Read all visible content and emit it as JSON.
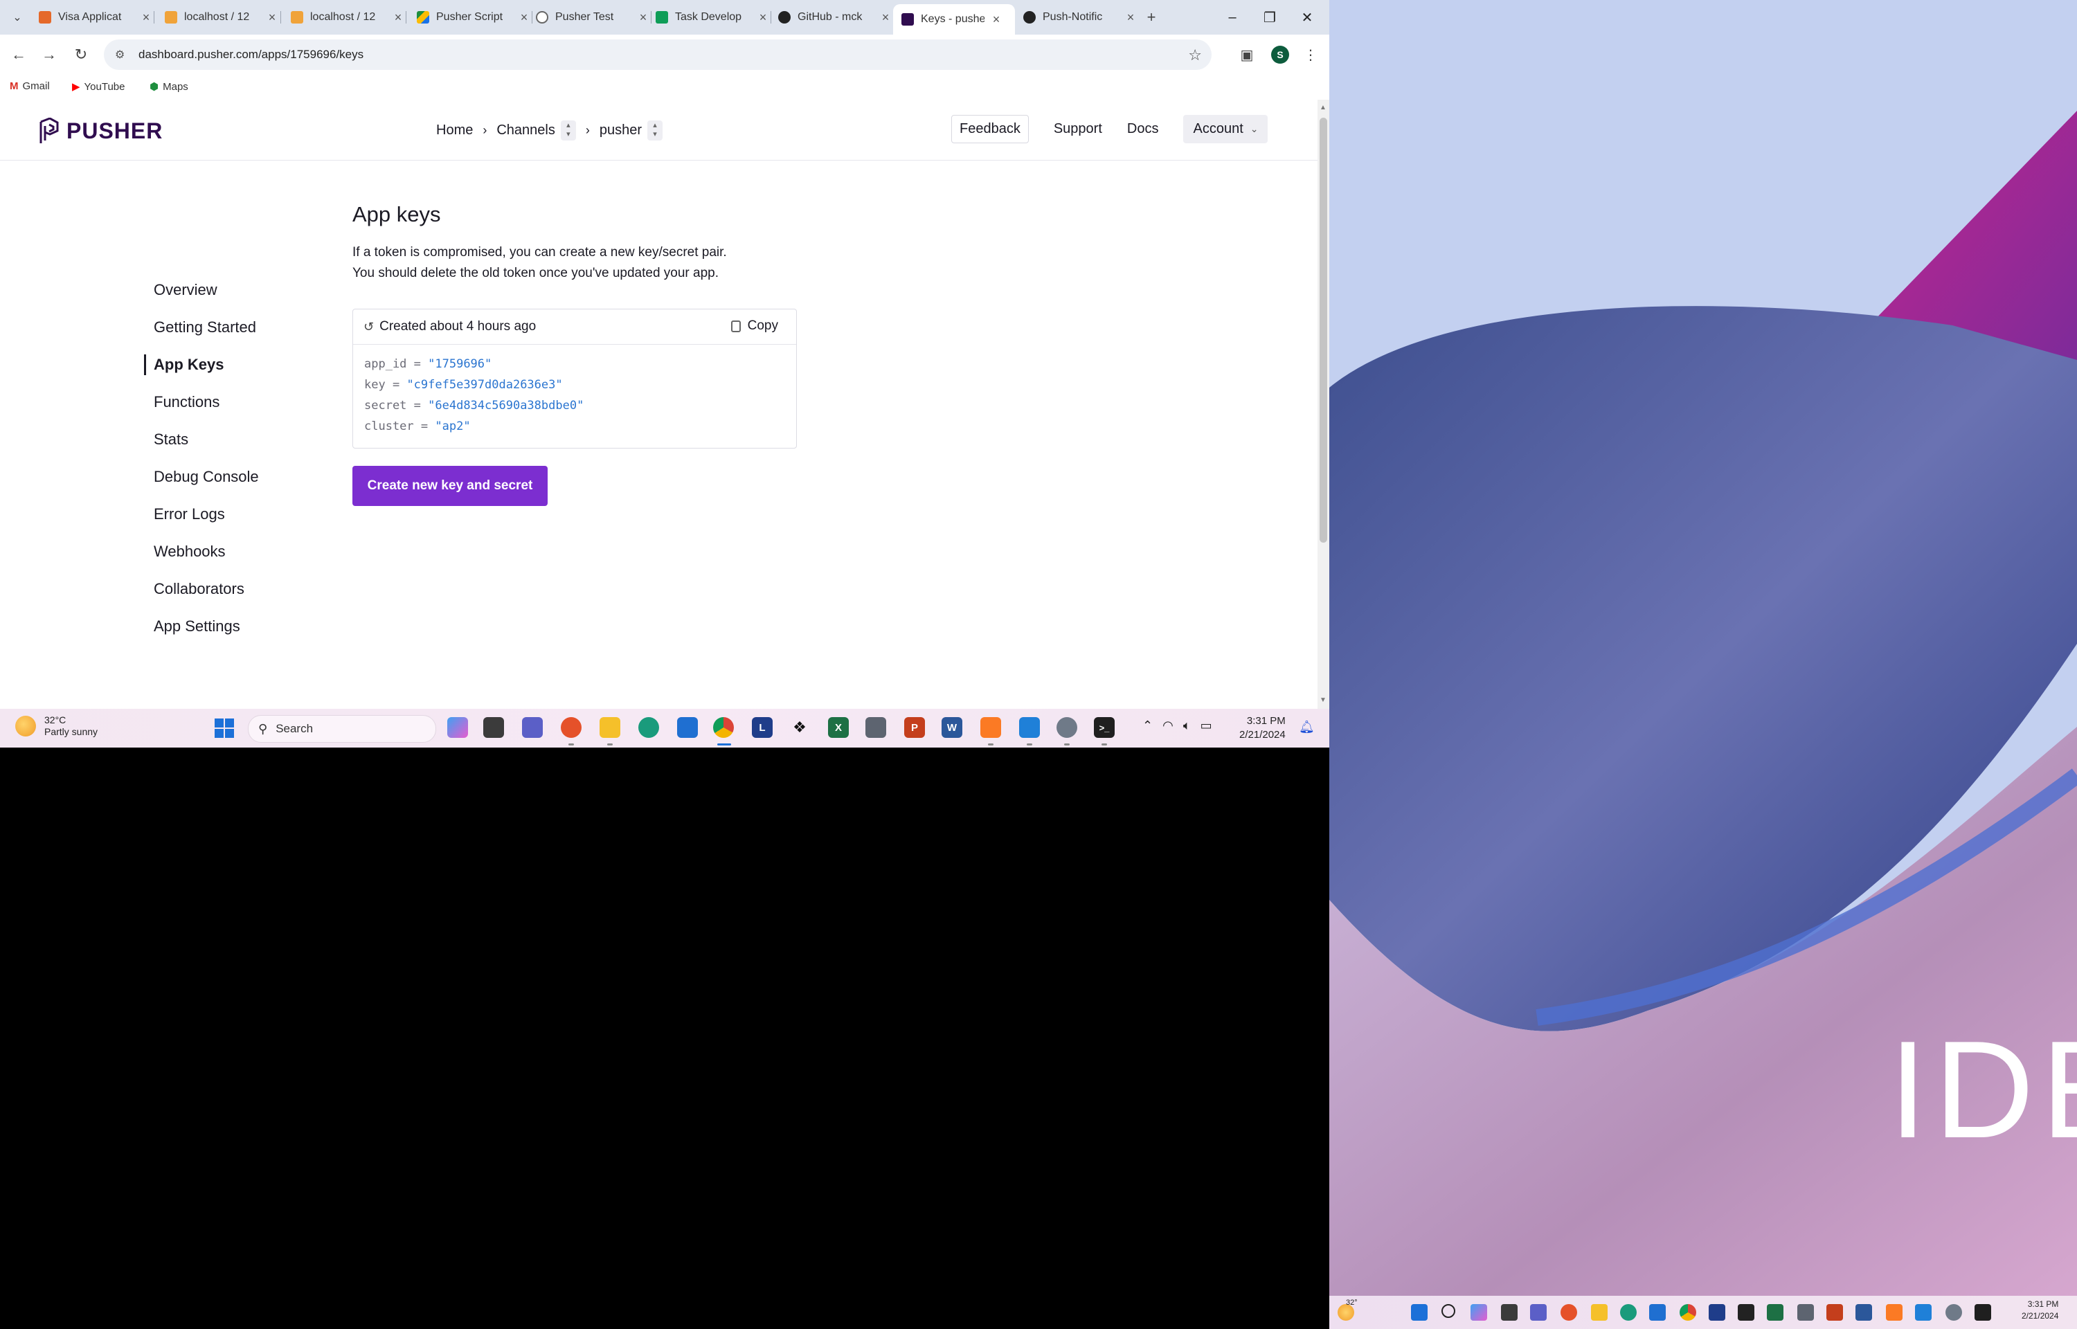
{
  "browser": {
    "tabs": [
      {
        "title": "Visa Applicat",
        "color": "#e5692a"
      },
      {
        "title": "localhost / 12",
        "color": "#f0a33a"
      },
      {
        "title": "localhost / 12",
        "color": "#f0a33a"
      },
      {
        "title": "Pusher Script",
        "color": "#1e8e3e"
      },
      {
        "title": "Pusher Test",
        "color": "#666666"
      },
      {
        "title": "Task Develop",
        "color": "#0f9d58"
      },
      {
        "title": "GitHub - mck",
        "color": "#222222"
      },
      {
        "title": "Keys - pusher",
        "color": "#300d4f"
      },
      {
        "title": "Push-Notific",
        "color": "#222222"
      }
    ],
    "active_tab_index": 7,
    "new_tab_glyph": "+",
    "url": "dashboard.pusher.com/apps/1759696/keys",
    "profile_initial": "S",
    "bookmarks": [
      {
        "label": "Gmail",
        "icon": "gmail-icon",
        "color": "#d93025"
      },
      {
        "label": "YouTube",
        "icon": "youtube-icon",
        "color": "#ff0000"
      },
      {
        "label": "Maps",
        "icon": "maps-icon",
        "color": "#1e8e3e"
      }
    ]
  },
  "pusher": {
    "logo_text": "PUSHER",
    "breadcrumb": {
      "home": "Home",
      "channels": "Channels",
      "app": "pusher"
    },
    "nav": {
      "feedback": "Feedback",
      "support": "Support",
      "docs": "Docs",
      "account": "Account"
    },
    "sidebar": {
      "items": [
        "Overview",
        "Getting Started",
        "App Keys",
        "Functions",
        "Stats",
        "Debug Console",
        "Error Logs",
        "Webhooks",
        "Collaborators",
        "App Settings"
      ],
      "active": "App Keys"
    },
    "page_title": "App keys",
    "description_line1": "If a token is compromised, you can create a new key/secret pair.",
    "description_line2": "You should delete the old token once you've updated your app.",
    "card": {
      "created": "Created about 4 hours ago",
      "copy_label": "Copy",
      "keys": [
        {
          "name": "app_id",
          "value": "\"1759696\""
        },
        {
          "name": "key",
          "value": "\"c9fef5e397d0da2636e3\""
        },
        {
          "name": "secret",
          "value": "\"6e4d834c5690a38bdbe0\""
        },
        {
          "name": "cluster",
          "value": "\"ap2\""
        }
      ]
    },
    "create_button": "Create new key and secret",
    "accent_color": "#7c2ed0"
  },
  "taskbar": {
    "weather_temp": "32°C",
    "weather_desc": "Partly sunny",
    "search_label": "Search",
    "time": "3:31 PM",
    "date": "2/21/2024"
  },
  "right_screen": {
    "wallpaper_text": "IDE",
    "weather_temp": "32°",
    "time": "3:31 PM",
    "date": "2/21/2024"
  }
}
